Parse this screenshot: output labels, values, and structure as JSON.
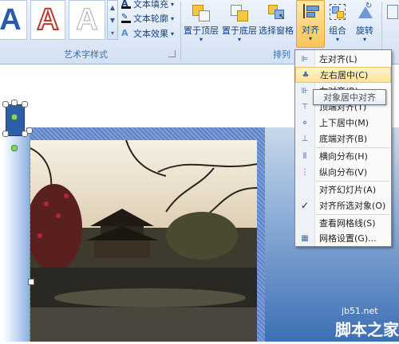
{
  "ribbon": {
    "wordart_group_label": "艺术字样式",
    "arrange_group_label": "排列",
    "gallery_letter": "A",
    "text_fill": "文本填充",
    "text_outline": "文本轮廓",
    "text_effects": "文本效果",
    "bring_front": "置于顶层",
    "send_back": "置于底层",
    "selection_pane": "选择窗格",
    "align": "对齐",
    "group": "组合",
    "rotate": "旋转"
  },
  "menu": {
    "items": [
      {
        "label": "左对齐(L)",
        "icon": "align-left-icon"
      },
      {
        "label": "左右居中(C)",
        "icon": "align-center-icon"
      },
      {
        "label": "右对齐(R)",
        "icon": "align-right-icon"
      },
      {
        "label": "顶端对齐(T)",
        "icon": "align-top-icon"
      },
      {
        "label": "上下居中(M)",
        "icon": "align-middle-icon"
      },
      {
        "label": "底端对齐(B)",
        "icon": "align-bottom-icon"
      },
      {
        "label": "横向分布(H)",
        "icon": "distribute-horizontal-icon"
      },
      {
        "label": "纵向分布(V)",
        "icon": "distribute-vertical-icon"
      },
      {
        "label": "对齐幻灯片(A)",
        "icon": "align-slide-icon"
      },
      {
        "label": "对齐所选对象(O)",
        "icon": "check-icon"
      },
      {
        "label": "查看网格线(S)",
        "icon": "gridlines-icon"
      },
      {
        "label": "网格设置(G)...",
        "icon": "grid-settings-icon"
      }
    ],
    "tooltip": "对象居中对齐"
  },
  "watermark": {
    "site": "jb51.net",
    "name": "脚本之家"
  },
  "colors": {
    "accent": "#15428b",
    "highlight": "#ffe39a",
    "ribbon": "#dde8f6"
  }
}
